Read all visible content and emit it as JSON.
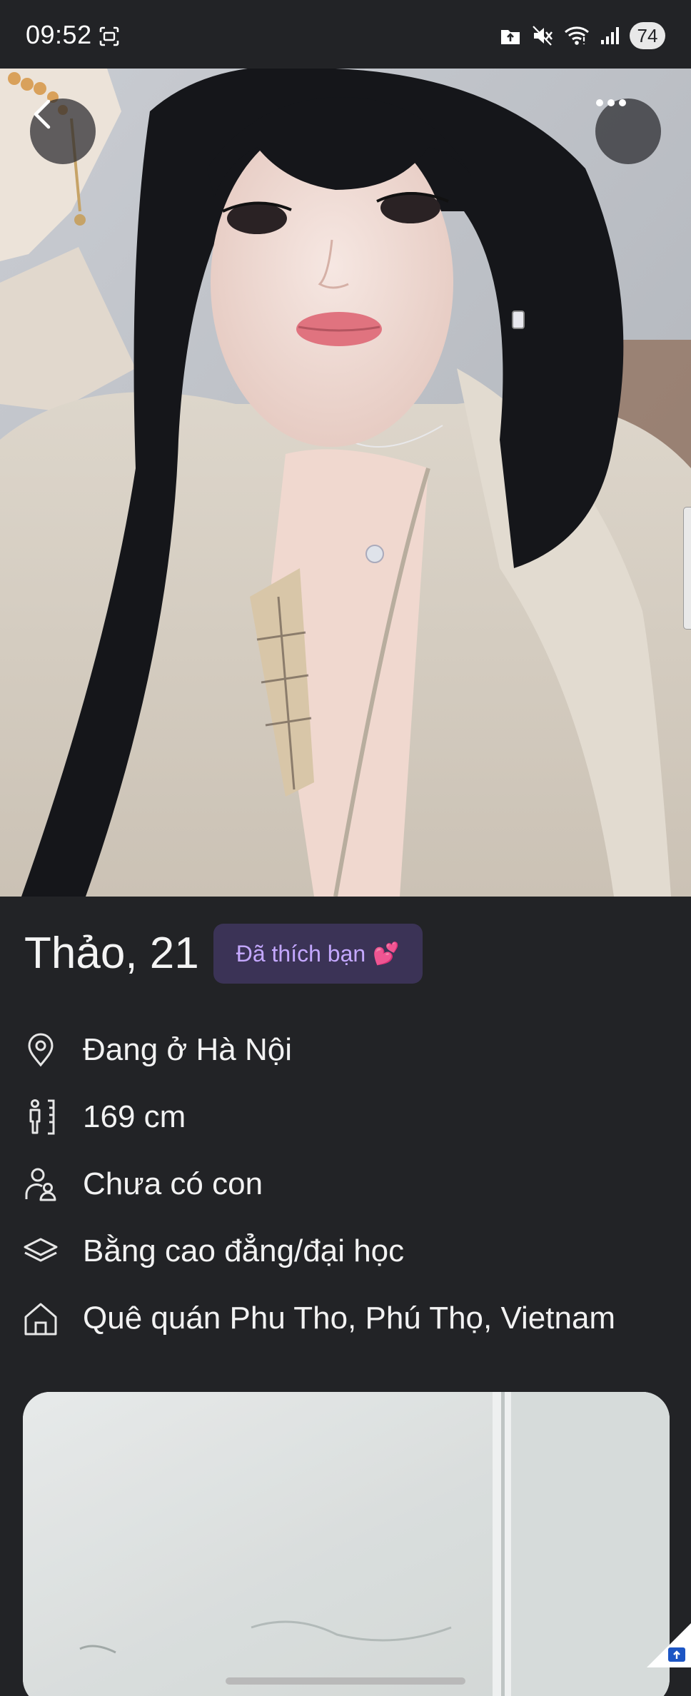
{
  "status_bar": {
    "time": "09:52",
    "battery": "74"
  },
  "profile": {
    "name_age": "Thảo, 21",
    "liked_badge": "Đã thích bạn",
    "liked_emoji": "💕",
    "details": [
      {
        "icon": "location-pin-icon",
        "text": "Đang ở Hà Nội"
      },
      {
        "icon": "height-ruler-icon",
        "text": "169 cm"
      },
      {
        "icon": "people-icon",
        "text": "Chưa có con"
      },
      {
        "icon": "education-cap-icon",
        "text": "Bằng cao đẳng/đại học"
      },
      {
        "icon": "home-icon",
        "text": "Quê quán Phu Tho, Phú Thọ, Vietnam"
      }
    ]
  },
  "colors": {
    "background": "#222326",
    "badge_bg": "#3b3356",
    "badge_text": "#c4a8ff"
  }
}
